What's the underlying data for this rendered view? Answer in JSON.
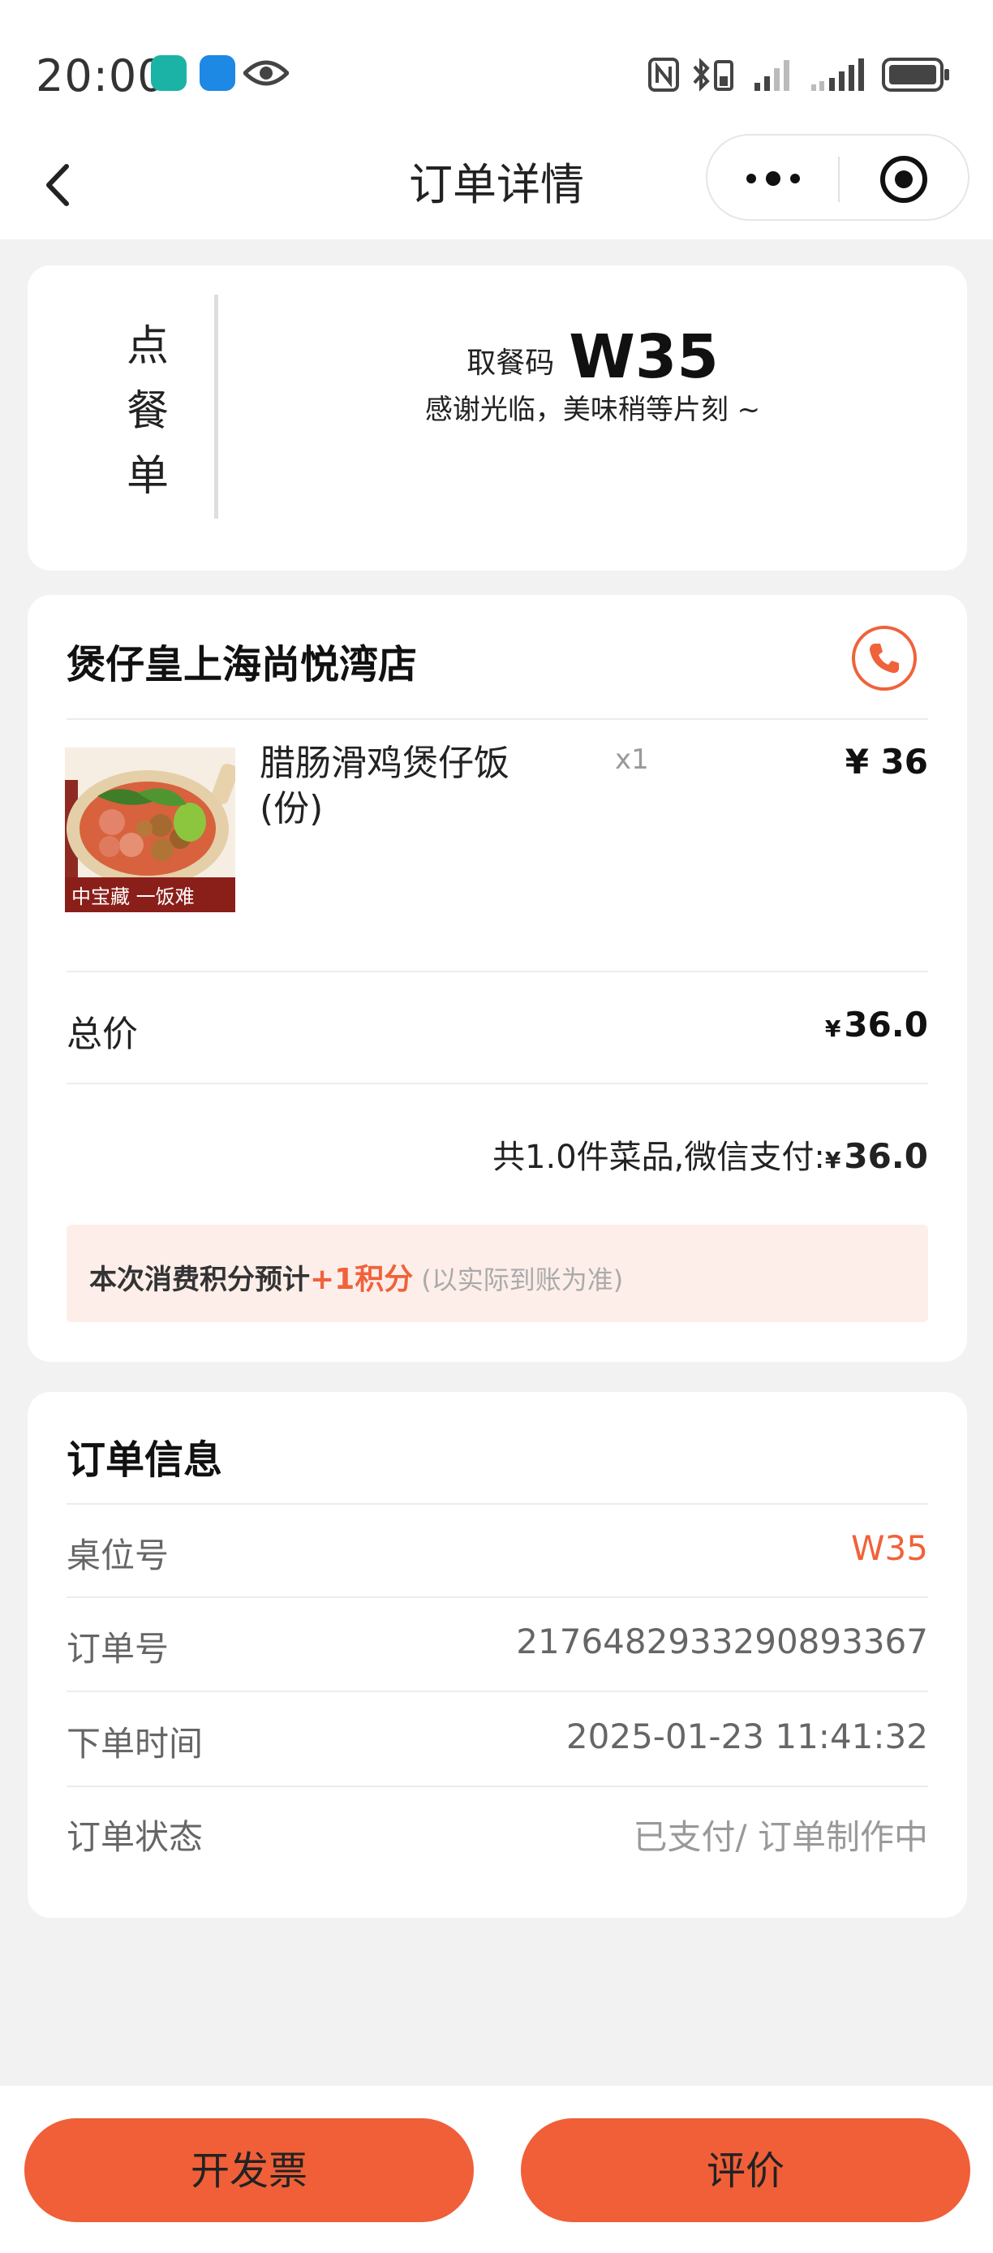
{
  "status_bar": {
    "time": "20:00"
  },
  "nav": {
    "title": "订单详情"
  },
  "pickup_card": {
    "vertical_label": [
      "点",
      "餐",
      "单"
    ],
    "code_label": "取餐码",
    "code": "W35",
    "message": "感谢光临，美味稍等片刻 ~"
  },
  "order_card": {
    "store_name": "煲仔皇上海尚悦湾店",
    "item": {
      "name": "腊肠滑鸡煲仔饭(份)",
      "quantity": "x1",
      "price": "¥ 36",
      "image_banner": "中宝藏  一饭难"
    },
    "total_label": "总价",
    "total_currency": "¥",
    "total_value": "36.0",
    "summary_text": "共1.0件菜品,微信支付:",
    "summary_currency": "¥",
    "summary_value": "36.0",
    "points_prefix": "本次消费积分预计",
    "points_value": "+1积分",
    "points_note": "(以实际到账为准)"
  },
  "order_info": {
    "title": "订单信息",
    "rows": [
      {
        "label": "桌位号",
        "value": "W35"
      },
      {
        "label": "订单号",
        "value": "2176482933290893367"
      },
      {
        "label": "下单时间",
        "value": "2025-01-23 11:41:32"
      },
      {
        "label": "订单状态",
        "value": "已支付/ 订单制作中"
      }
    ]
  },
  "actions": {
    "invoice": "开发票",
    "review": "评价"
  },
  "colors": {
    "accent": "#f0623a",
    "button": "#f05f38",
    "points_bg": "#fdeeea"
  }
}
